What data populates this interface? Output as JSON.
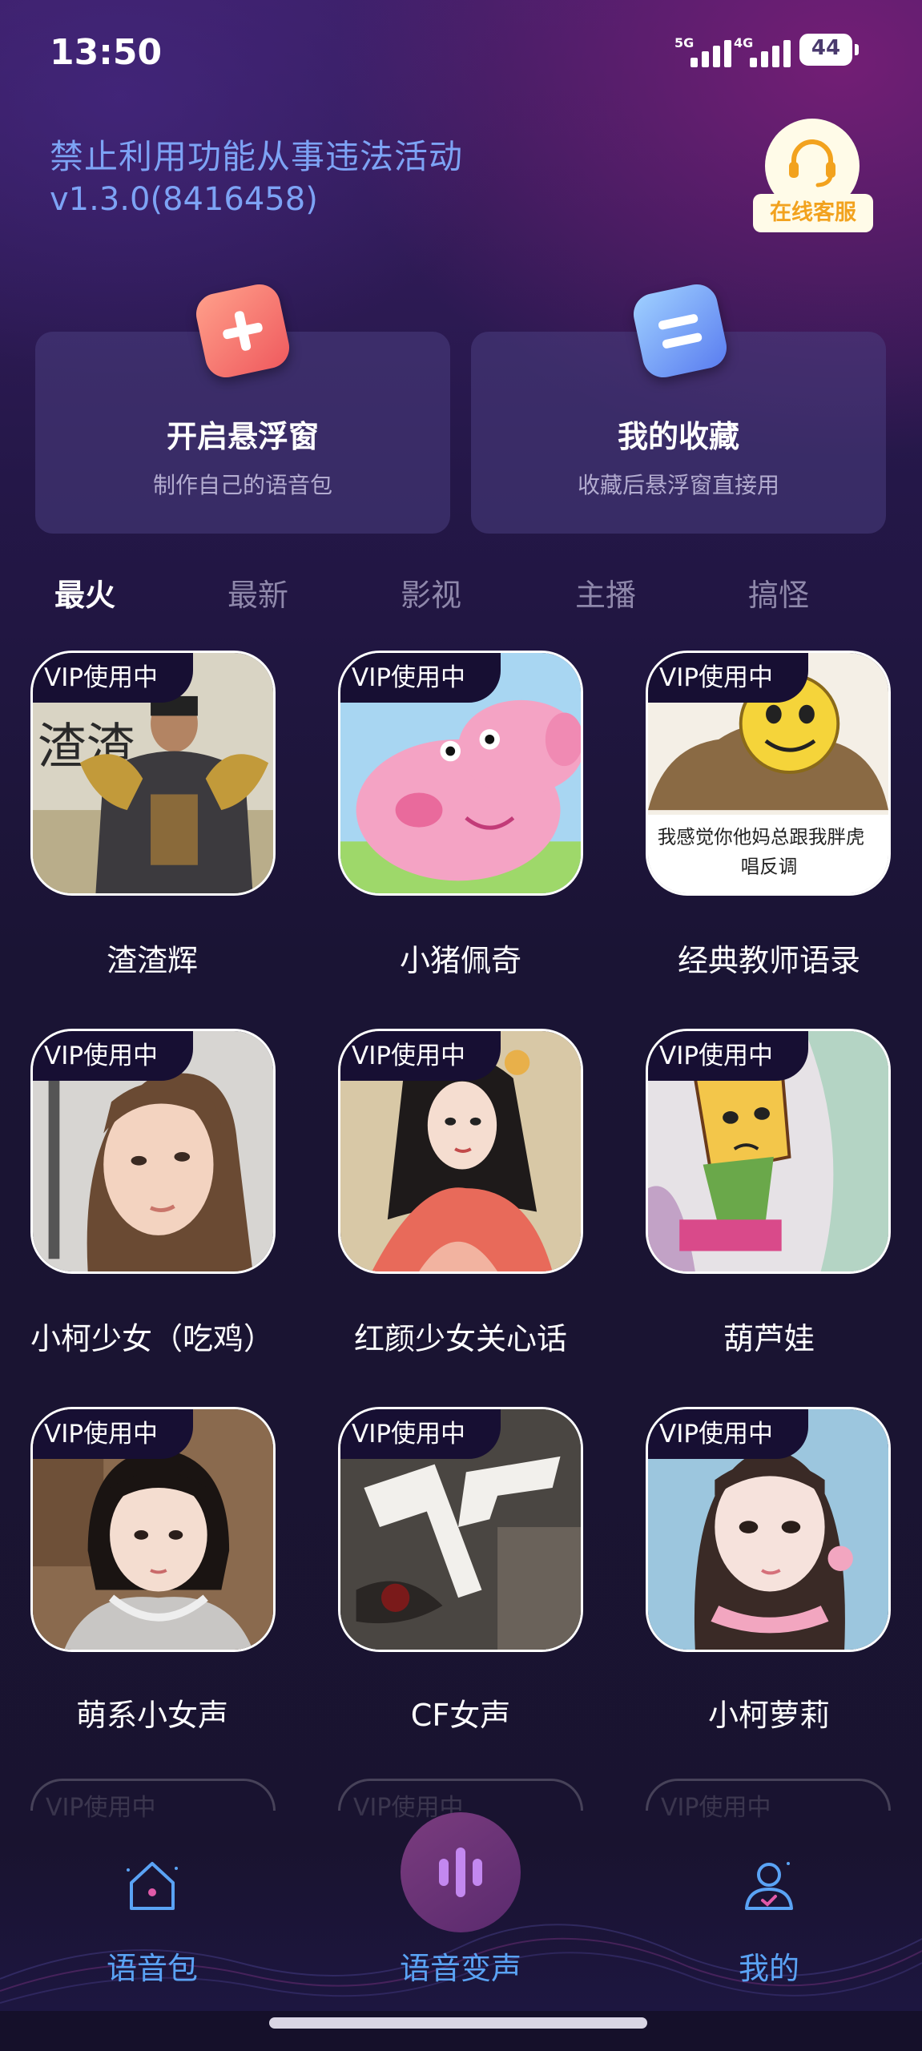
{
  "status_bar": {
    "time": "13:50",
    "signal_1": "5G",
    "signal_2": "4G",
    "battery": "44"
  },
  "header": {
    "warning": "禁止利用功能从事违法活动",
    "version": "v1.3.0(8416458)",
    "service_label": "在线客服"
  },
  "features": [
    {
      "title": "开启悬浮窗",
      "subtitle": "制作自己的语音包",
      "icon": "plus-icon"
    },
    {
      "title": "我的收藏",
      "subtitle": "收藏后悬浮窗直接用",
      "icon": "list-icon"
    }
  ],
  "tabs": [
    "最火",
    "最新",
    "影视",
    "主播",
    "搞怪"
  ],
  "active_tab": "最火",
  "badge": "VIP使用中",
  "cards": [
    {
      "name": "渣渣辉",
      "art": "armored-man",
      "art_caption": "渣渣"
    },
    {
      "name": "小猪佩奇",
      "art": "peppa-pig"
    },
    {
      "name": "经典教师语录",
      "art": "meme-face",
      "art_caption": "我感觉你他妈总跟我胖虎唱反调"
    },
    {
      "name": "小柯少女（吃鸡）",
      "art": "girl-portrait"
    },
    {
      "name": "红颜少女关心话",
      "art": "painted-lady"
    },
    {
      "name": "葫芦娃",
      "art": "calabash-boy"
    },
    {
      "name": "萌系小女声",
      "art": "girl-headphones"
    },
    {
      "name": "CF女声",
      "art": "cf-logo"
    },
    {
      "name": "小柯萝莉",
      "art": "girl-pink"
    }
  ],
  "bottom_nav": [
    {
      "label": "语音包",
      "icon": "home-icon"
    },
    {
      "label": "语音变声",
      "icon": "voice-icon"
    },
    {
      "label": "我的",
      "icon": "user-icon"
    }
  ],
  "colors": {
    "accent_blue": "#7da3f5",
    "nav_label": "#5aa3f5",
    "service_orange": "#f2a21e",
    "card_bg": "#3b3270"
  }
}
